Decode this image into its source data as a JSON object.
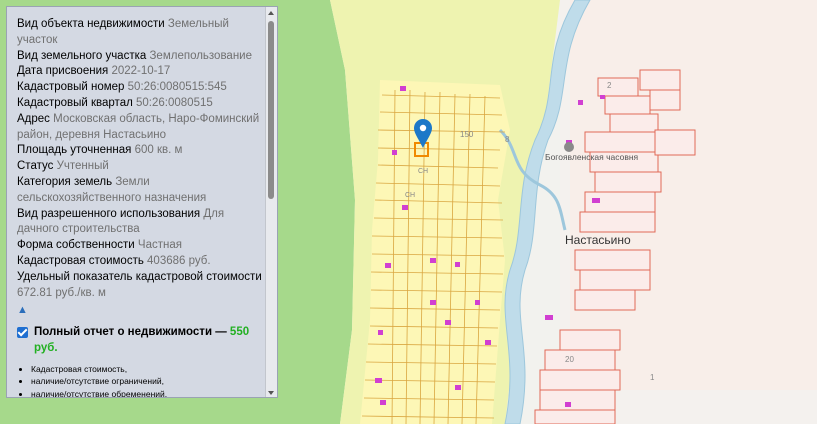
{
  "info_panel": {
    "rows": [
      {
        "label": "Вид объекта недвижимости",
        "value": "Земельный участок"
      },
      {
        "label": "Вид земельного участка",
        "value": "Землепользование"
      },
      {
        "label": "Дата присвоения",
        "value": "2022-10-17"
      },
      {
        "label": "Кадастровый номер",
        "value": "50:26:0080515:545"
      },
      {
        "label": "Кадастровый квартал",
        "value": "50:26:0080515"
      },
      {
        "label": "Адрес",
        "value": "Московская область, Наро-Фоминский район, деревня Настасьино"
      },
      {
        "label": "Площадь уточненная",
        "value": "600 кв. м"
      },
      {
        "label": "Статус",
        "value": "Учтенный"
      },
      {
        "label": "Категория земель",
        "value": "Земли сельскохозяйственного назначения"
      },
      {
        "label": "Вид разрешенного использования",
        "value": "Для дачного строительства"
      },
      {
        "label": "Форма собственности",
        "value": "Частная"
      },
      {
        "label": "Кадастровая стоимость",
        "value": "403686 руб."
      },
      {
        "label": "Удельный показатель кадастровой стоимости",
        "value": "672.81 руб./кв. м"
      }
    ],
    "collapse_icon": "▲",
    "report": {
      "checked": true,
      "title": "Полный отчет о недвижимости —",
      "price": "550 руб.",
      "items": [
        "Кадастровая стоимость,",
        "наличие/отсутствие ограничений,",
        "наличие/отсутствие обременений,"
      ]
    }
  },
  "map": {
    "labels": {
      "village": "Настасьино",
      "chapel": "Богоявленская часовня",
      "num_150": "150",
      "num_8": "8",
      "num_2": "2",
      "num_20": "20",
      "num_1": "1",
      "sn1": "СН",
      "sn2": "СН"
    },
    "colors": {
      "forest": "#a8d98e",
      "field": "#f0f4b0",
      "snt_area": "#fdf7b8",
      "water": "#c3dfee",
      "parcel_line": "#d6a23a",
      "house_parcel": "#e46b5b",
      "building": "#d13fd1",
      "selected_parcel": "#f08a00",
      "marker": "#1c78c8"
    }
  }
}
